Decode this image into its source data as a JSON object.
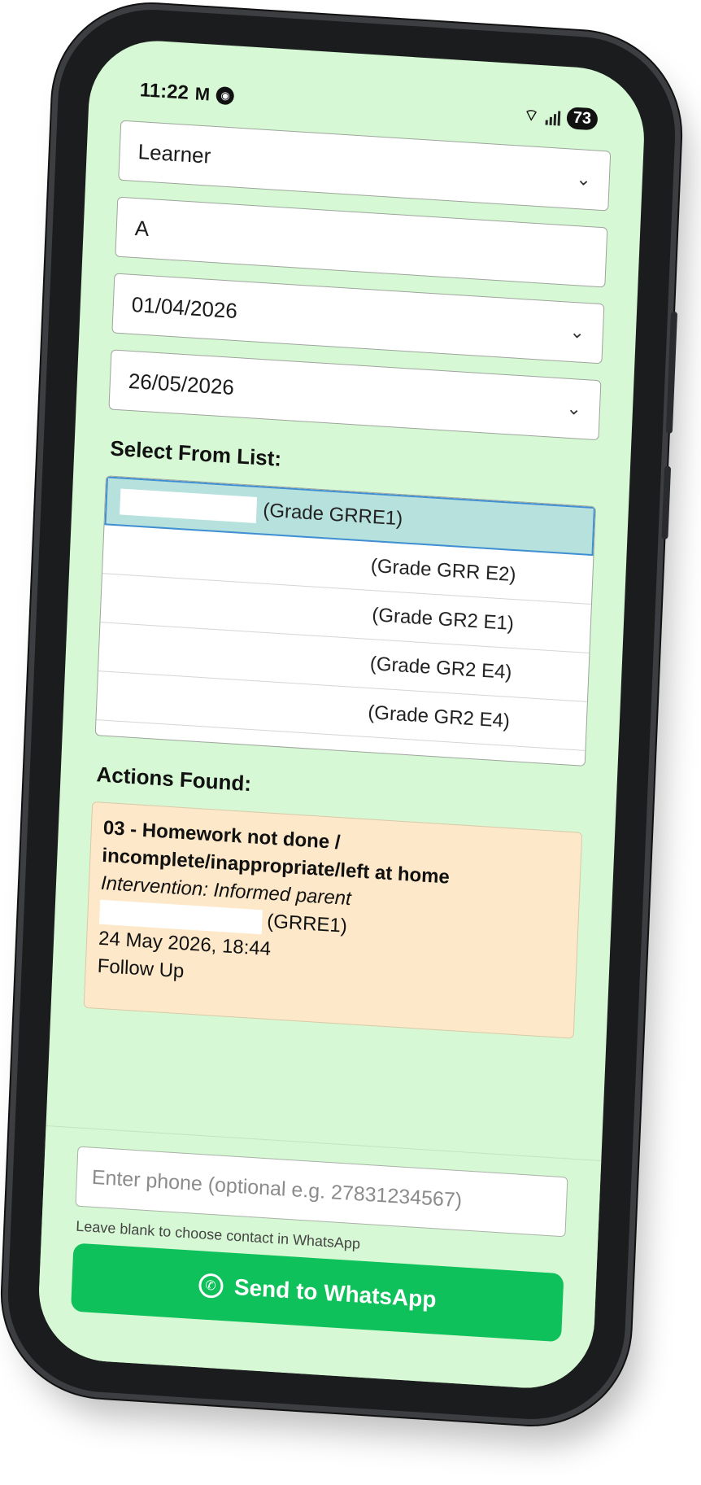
{
  "status_bar": {
    "time": "11:22",
    "mail_icon": "gmail-icon",
    "app_icon": "app-notification-icon",
    "battery": "73"
  },
  "filters": {
    "type_select": "Learner",
    "search_value": "A",
    "date_from": "01/04/2026",
    "date_to": "26/05/2026"
  },
  "list": {
    "title": "Select From List:",
    "items": [
      {
        "label": "(Grade GRRE1)",
        "selected": true
      },
      {
        "label": "(Grade GRR E2)",
        "selected": false
      },
      {
        "label": "(Grade GR2 E1)",
        "selected": false
      },
      {
        "label": "(Grade GR2 E4)",
        "selected": false
      },
      {
        "label": "(Grade GR2 E4)",
        "selected": false
      }
    ]
  },
  "actions": {
    "title": "Actions Found:",
    "cards": [
      {
        "title": "03 - Homework not done / incomplete/inappropriate/left at home",
        "intervention": "Intervention: Informed parent",
        "learner_grade": "(GRRE1)",
        "datetime": "24 May 2026, 18:44",
        "status": "Follow Up"
      }
    ]
  },
  "whatsapp": {
    "phone_placeholder": "Enter phone (optional e.g. 27831234567)",
    "hint": "Leave blank to choose contact in WhatsApp",
    "send_label": "Send to WhatsApp",
    "button_color": "#0fc15a"
  },
  "colors": {
    "screen_background": "#d7f8d4",
    "selected_row": "#b6e1dd",
    "action_card": "#fde9c9"
  }
}
